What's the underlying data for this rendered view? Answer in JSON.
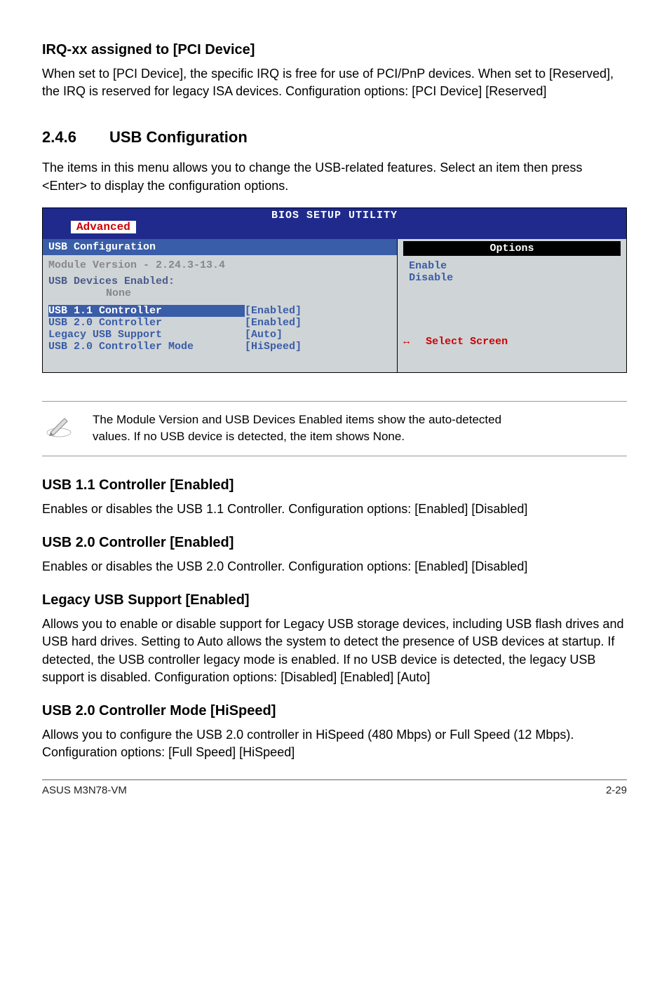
{
  "irq": {
    "heading": "IRQ-xx assigned to [PCI Device]",
    "body": "When set to [PCI Device], the specific IRQ is free for use of PCI/PnP devices. When set to [Reserved], the IRQ is reserved for legacy ISA devices. Configuration options: [PCI Device] [Reserved]"
  },
  "section": {
    "number": "2.4.6",
    "title": "USB Configuration",
    "intro": "The items in this menu allows you to change the USB-related features. Select an item then press <Enter> to display the configuration options."
  },
  "bios": {
    "window_title": "BIOS SETUP UTILITY",
    "tab": "Advanced",
    "left_title": "USB Configuration",
    "module_version": "Module Version - 2.24.3-13.4",
    "devices_label": "USB Devices Enabled:",
    "devices_none": "None",
    "rows": [
      {
        "k": "USB 1.1 Controller",
        "v": "[Enabled]",
        "hl": true
      },
      {
        "k": "USB 2.0 Controller",
        "v": "[Enabled]",
        "hl": false
      },
      {
        "k": "Legacy USB Support",
        "v": "[Auto]",
        "hl": false
      },
      {
        "k": "USB 2.0 Controller Mode",
        "v": "[HiSpeed]",
        "hl": false
      }
    ],
    "options_title": "Options",
    "options": [
      "Enable",
      "Disable"
    ],
    "help_arrow": "↔",
    "help_text": "Select Screen"
  },
  "note": {
    "text": "The Module Version and USB Devices Enabled items show the auto-detected values. If no USB device is detected, the item shows None."
  },
  "settings": [
    {
      "h": "USB 1.1 Controller [Enabled]",
      "b": "Enables or disables the USB 1.1 Controller. Configuration options: [Enabled] [Disabled]"
    },
    {
      "h": "USB 2.0 Controller [Enabled]",
      "b": "Enables or disables the USB 2.0 Controller. Configuration options:  [Enabled] [Disabled]"
    },
    {
      "h": "Legacy USB Support [Enabled]",
      "b": "Allows you to enable or disable support for Legacy USB storage devices, including USB flash drives and USB hard drives. Setting to Auto allows the system to detect the presence of USB devices at startup. If detected, the USB controller legacy mode is enabled. If no USB device is detected, the legacy USB support is disabled. Configuration options: [Disabled] [Enabled] [Auto]"
    },
    {
      "h": "USB 2.0 Controller Mode [HiSpeed]",
      "b": "Allows you to configure the USB 2.0 controller in HiSpeed (480 Mbps) or Full Speed (12 Mbps). Configuration options: [Full Speed] [HiSpeed]"
    }
  ],
  "footer": {
    "left": "ASUS M3N78-VM",
    "right": "2-29"
  }
}
